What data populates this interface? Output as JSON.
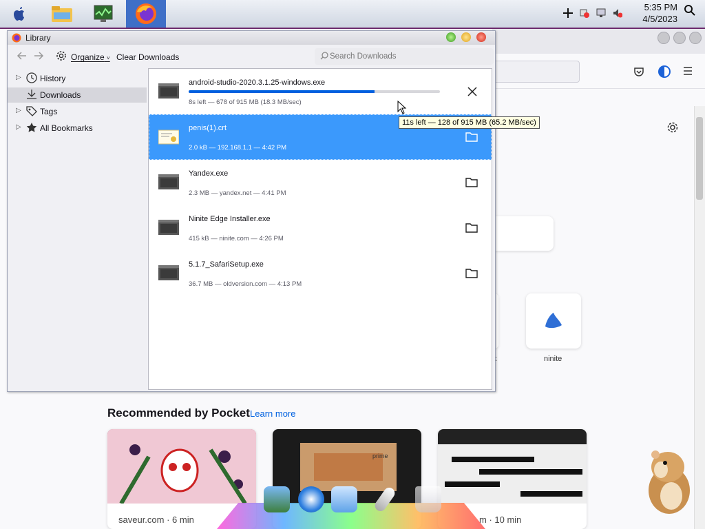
{
  "taskbar": {
    "apps": [
      "apple-menu",
      "file-explorer",
      "task-manager",
      "firefox"
    ],
    "clock_time": "5:35 PM",
    "clock_date": "4/5/2023"
  },
  "library": {
    "title": "Library",
    "toolbar": {
      "organize_label": "Organize",
      "clear_label": "Clear Downloads",
      "search_placeholder": "Search Downloads"
    },
    "sidebar": {
      "items": [
        {
          "label": "History",
          "icon": "clock-icon",
          "expandable": true,
          "selected": false
        },
        {
          "label": "Downloads",
          "icon": "download-icon",
          "expandable": false,
          "selected": true
        },
        {
          "label": "Tags",
          "icon": "tag-icon",
          "expandable": true,
          "selected": false
        },
        {
          "label": "All Bookmarks",
          "icon": "star-icon",
          "expandable": true,
          "selected": false
        }
      ]
    },
    "downloads": [
      {
        "name": "android-studio-2020.3.1.25-windows.exe",
        "status": "8s left — 678 of 915 MB (18.3 MB/sec)",
        "progress": 0.74,
        "action": "cancel",
        "selected": false
      },
      {
        "name": "penis(1).crt",
        "status": "2.0 kB — 192.168.1.1 — 4:42 PM",
        "action": "show-in-folder",
        "selected": true
      },
      {
        "name": "Yandex.exe",
        "status": "2.3 MB — yandex.net — 4:41 PM",
        "action": "show-in-folder",
        "selected": false
      },
      {
        "name": "Ninite Edge Installer.exe",
        "status": "415 kB — ninite.com — 4:26 PM",
        "action": "show-in-folder",
        "selected": false
      },
      {
        "name": "5.1.7_SafariSetup.exe",
        "status": "36.7 MB — oldversion.com — 4:13 PM",
        "action": "show-in-folder",
        "selected": false
      }
    ],
    "tooltip": "11s left — 128 of 915 MB (65.2 MB/sec)"
  },
  "firefox": {
    "shortcut_partial_label": "x",
    "shortcut_label": "ninite",
    "pocket": {
      "title": "Recommended by Pocket",
      "learn_more": "Learn more",
      "cards": [
        {
          "source": "saveur.com · 6 min",
          "color": "#b04a6a"
        },
        {
          "source": "",
          "color": "#7a5a3a"
        },
        {
          "source": "m · 10 min",
          "color": "#cfcfcf"
        }
      ]
    }
  },
  "dock": {
    "items": [
      "photos",
      "safari",
      "system-preferences",
      "pen",
      "trash"
    ]
  }
}
